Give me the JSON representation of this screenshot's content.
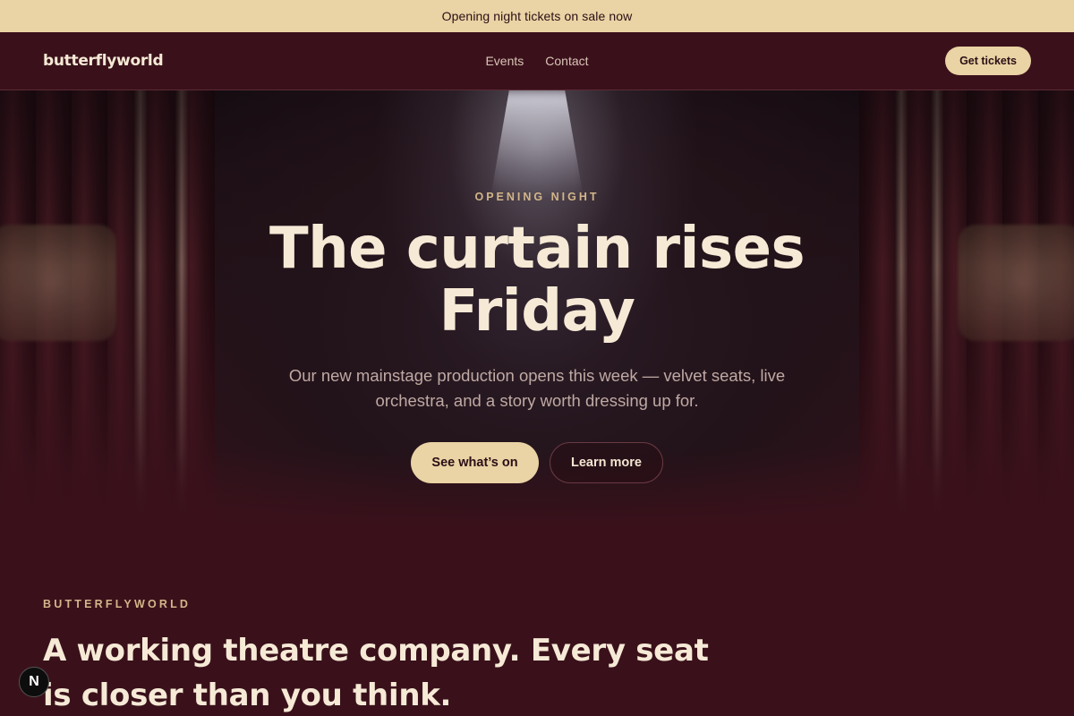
{
  "announcement": "Opening night tickets on sale now",
  "nav": {
    "logo": "butterflyworld",
    "links": [
      "Events",
      "Contact"
    ],
    "cta": "Get tickets"
  },
  "hero": {
    "eyebrow": "OPENING NIGHT",
    "headline_line1": "The curtain rises",
    "headline_line2": "Friday",
    "subtitle": "Our new mainstage production opens this week — velvet seats, live orchestra, and a story worth dressing up for.",
    "primary_button": "See what’s on",
    "secondary_button": "Learn more"
  },
  "about": {
    "eyebrow": "BUTTERFLYWORLD",
    "title": "A working theatre company. Every seat is closer than you think."
  },
  "dev_badge": "N",
  "colors": {
    "background": "#3a111b",
    "announcement_bg": "#ead3a4",
    "accent": "#ead3a4",
    "eyebrow": "#d3b589",
    "heading": "#f6ead6"
  },
  "icons": {
    "dev_badge": "nextjs-logo-icon"
  }
}
